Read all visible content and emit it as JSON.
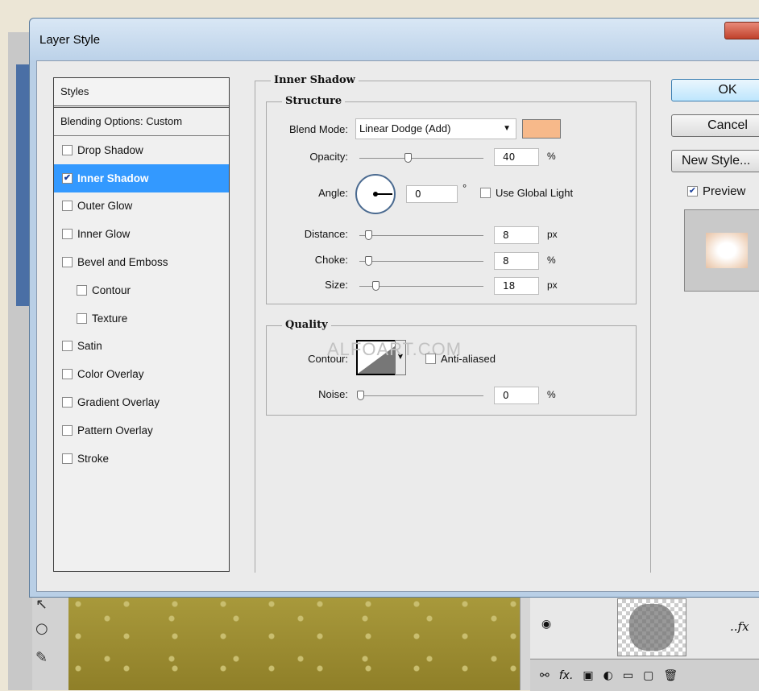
{
  "window": {
    "title": "Layer Style"
  },
  "styles_panel": {
    "header": "Styles",
    "blending_options": "Blending Options: Custom",
    "items": [
      {
        "label": "Drop Shadow",
        "checked": false,
        "selected": false,
        "sub": false
      },
      {
        "label": "Inner Shadow",
        "checked": true,
        "selected": true,
        "sub": false
      },
      {
        "label": "Outer Glow",
        "checked": false,
        "selected": false,
        "sub": false
      },
      {
        "label": "Inner Glow",
        "checked": false,
        "selected": false,
        "sub": false
      },
      {
        "label": "Bevel and Emboss",
        "checked": false,
        "selected": false,
        "sub": false
      },
      {
        "label": "Contour",
        "checked": false,
        "selected": false,
        "sub": true
      },
      {
        "label": "Texture",
        "checked": false,
        "selected": false,
        "sub": true
      },
      {
        "label": "Satin",
        "checked": false,
        "selected": false,
        "sub": false
      },
      {
        "label": "Color Overlay",
        "checked": false,
        "selected": false,
        "sub": false
      },
      {
        "label": "Gradient Overlay",
        "checked": false,
        "selected": false,
        "sub": false
      },
      {
        "label": "Pattern Overlay",
        "checked": false,
        "selected": false,
        "sub": false
      },
      {
        "label": "Stroke",
        "checked": false,
        "selected": false,
        "sub": false
      }
    ]
  },
  "inner_shadow": {
    "title": "Inner Shadow",
    "structure": {
      "title": "Structure",
      "blend_mode_label": "Blend Mode:",
      "blend_mode_value": "Linear Dodge (Add)",
      "color": "#f7b98a",
      "opacity_label": "Opacity:",
      "opacity_value": "40",
      "opacity_unit": "%",
      "angle_label": "Angle:",
      "angle_value": "0",
      "angle_unit": "°",
      "use_global_light_label": "Use Global Light",
      "distance_label": "Distance:",
      "distance_value": "8",
      "distance_unit": "px",
      "choke_label": "Choke:",
      "choke_value": "8",
      "choke_unit": "%",
      "size_label": "Size:",
      "size_value": "18",
      "size_unit": "px"
    },
    "quality": {
      "title": "Quality",
      "contour_label": "Contour:",
      "anti_aliased_label": "Anti-aliased",
      "noise_label": "Noise:",
      "noise_value": "0",
      "noise_unit": "%"
    },
    "watermark": "ALFOART.COM"
  },
  "buttons": {
    "ok": "OK",
    "cancel": "Cancel",
    "new_style": "New Style...",
    "preview_label": "Preview"
  }
}
